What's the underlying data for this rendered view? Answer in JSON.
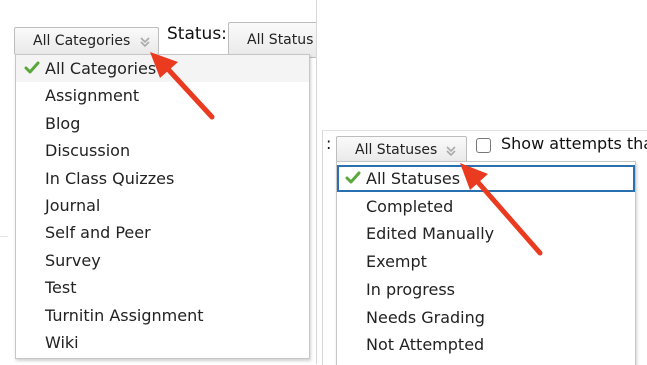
{
  "left": {
    "category_select": {
      "value": "All Categories"
    },
    "status_label": "Status:",
    "status_select_partial": "All Status",
    "category_options": [
      {
        "label": "All Categories",
        "selected": true
      },
      {
        "label": "Assignment",
        "selected": false
      },
      {
        "label": "Blog",
        "selected": false
      },
      {
        "label": "Discussion",
        "selected": false
      },
      {
        "label": "In Class Quizzes",
        "selected": false
      },
      {
        "label": "Journal",
        "selected": false
      },
      {
        "label": "Self and Peer",
        "selected": false
      },
      {
        "label": "Survey",
        "selected": false
      },
      {
        "label": "Test",
        "selected": false
      },
      {
        "label": "Turnitin Assignment",
        "selected": false
      },
      {
        "label": "Wiki",
        "selected": false
      }
    ]
  },
  "right": {
    "colon_fragment": ":",
    "status_select": {
      "value": "All Statuses"
    },
    "show_attempts_label": "Show attempts tha",
    "status_options": [
      {
        "label": "All Statuses",
        "selected": true
      },
      {
        "label": "Completed",
        "selected": false
      },
      {
        "label": "Edited Manually",
        "selected": false
      },
      {
        "label": "Exempt",
        "selected": false
      },
      {
        "label": "In progress",
        "selected": false
      },
      {
        "label": "Needs Grading",
        "selected": false
      },
      {
        "label": "Not Attempted",
        "selected": false
      }
    ]
  },
  "colors": {
    "check_green": "#5aa83c",
    "arrow_red": "#ea3a1f",
    "focus_blue": "#2a6fb0"
  }
}
